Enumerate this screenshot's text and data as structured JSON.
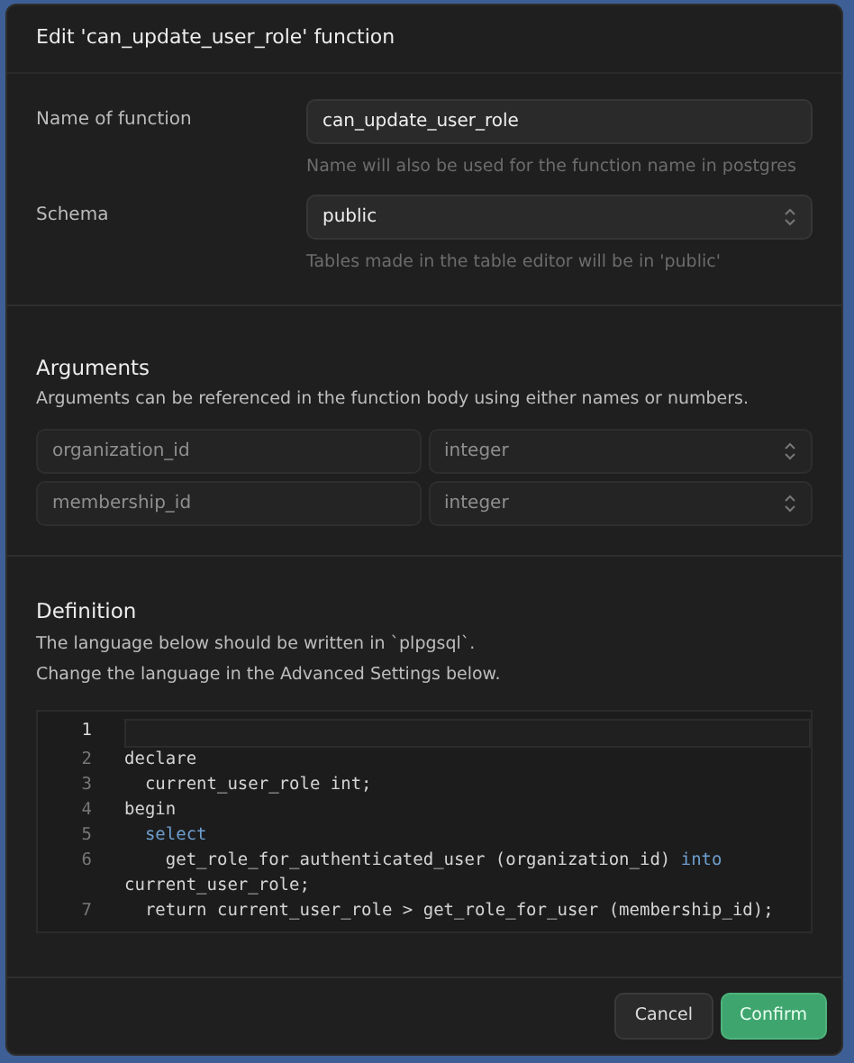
{
  "dialog": {
    "title": "Edit 'can_update_user_role' function"
  },
  "general": {
    "fields": [
      {
        "kind": "text",
        "label": "Name of function",
        "value": "can_update_user_role",
        "help": "Name will also be used for the function name in postgres"
      },
      {
        "kind": "select",
        "label": "Schema",
        "value": "public",
        "help": "Tables made in the table editor will be in 'public'"
      }
    ]
  },
  "arguments": {
    "title": "Arguments",
    "description": "Arguments can be referenced in the function body using either names or numbers.",
    "rows": [
      {
        "name": "organization_id",
        "type": "integer"
      },
      {
        "name": "membership_id",
        "type": "integer"
      }
    ]
  },
  "definition": {
    "title": "Definition",
    "description_lines": [
      "The language below should be written in `plpgsql`.",
      "Change the language in the Advanced Settings below."
    ],
    "code_lines": [
      {
        "number": "1",
        "current": true
      },
      {
        "number": "2",
        "tokens": [
          {
            "kind": "plain",
            "text": "declare"
          }
        ],
        "current": false
      },
      {
        "number": "3",
        "tokens": [
          {
            "kind": "plain",
            "text": "  current_user_role int;"
          }
        ],
        "current": false
      },
      {
        "number": "4",
        "tokens": [
          {
            "kind": "plain",
            "text": "begin"
          }
        ],
        "current": false
      },
      {
        "number": "5",
        "tokens": [
          {
            "kind": "keyword",
            "text": "  select"
          }
        ],
        "current": false
      },
      {
        "number": "6",
        "tokens": [
          {
            "kind": "plain",
            "text": "    get_role_for_authenticated_user (organization_id) "
          },
          {
            "kind": "keyword",
            "text": "into"
          }
        ],
        "wrap": "current_user_role;",
        "current": false
      },
      {
        "number": "7",
        "tokens": [
          {
            "kind": "plain",
            "text": "  return current_user_role > get_role_for_user (membership_id);"
          }
        ],
        "current": false
      }
    ]
  },
  "footer": {
    "buttons": [
      {
        "kind": "secondary",
        "label": "Cancel"
      },
      {
        "kind": "primary",
        "label": "Confirm"
      }
    ]
  }
}
